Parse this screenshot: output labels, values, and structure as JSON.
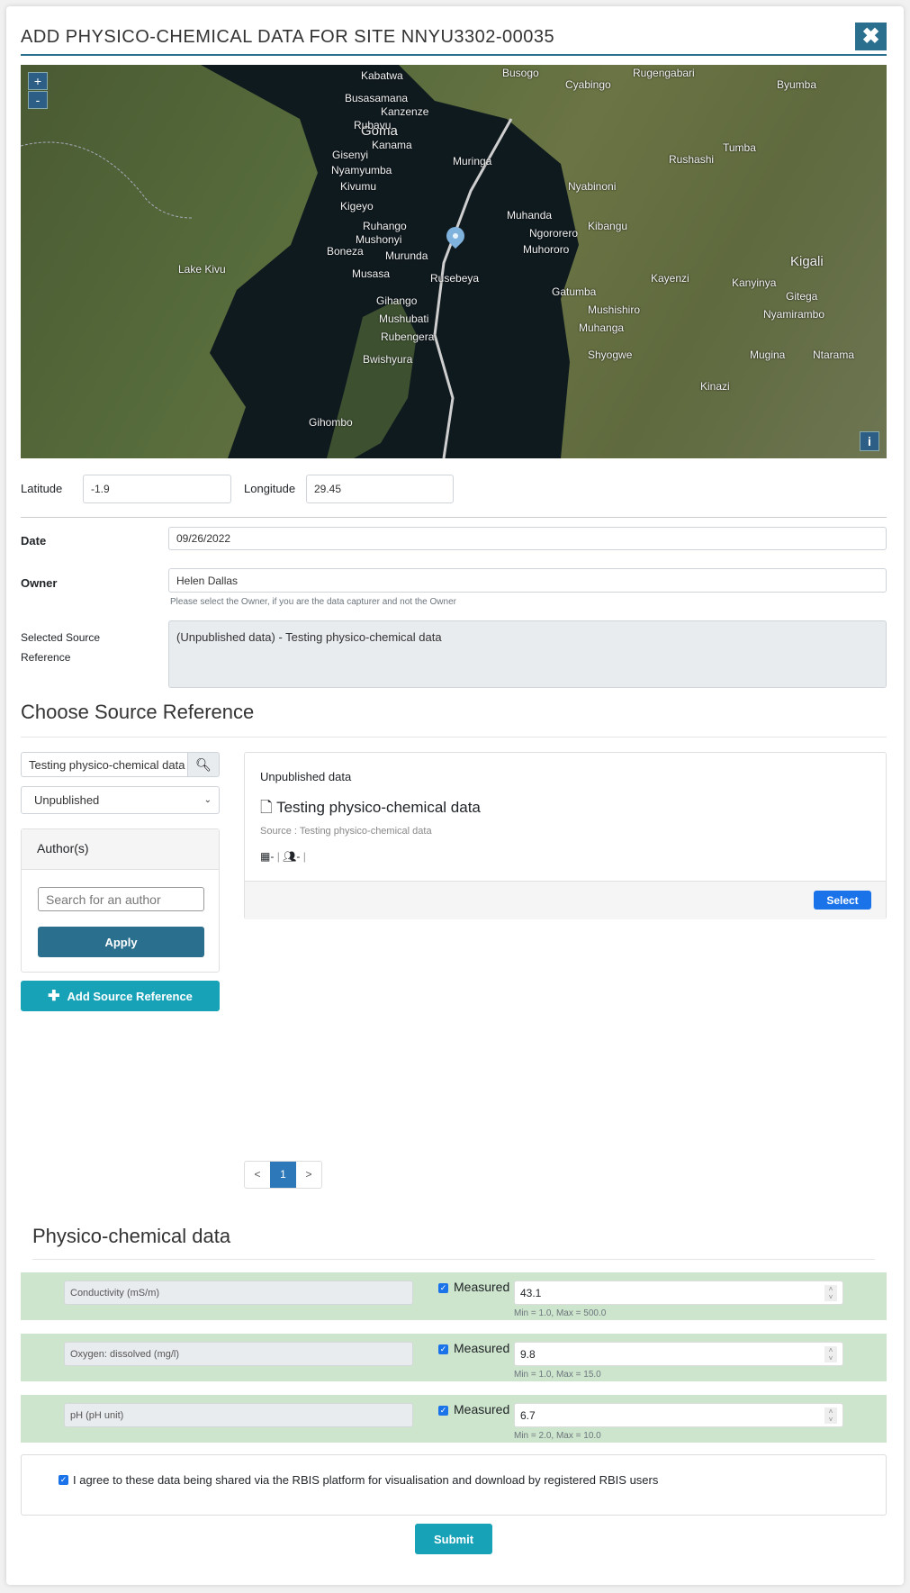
{
  "modal": {
    "title": "ADD PHYSICO-CHEMICAL DATA FOR SITE NNYU3302-00035",
    "close_icon": "close-icon"
  },
  "map": {
    "zoom_in": "+",
    "zoom_out": "-",
    "info": "i",
    "labels": [
      "Goma",
      "Gisenyi",
      "Kabatwa",
      "Busasamana",
      "Kanzenze",
      "Rubavu",
      "Kanama",
      "Nyamyumba",
      "Kivumu",
      "Kigeyo",
      "Ruhango",
      "Mushonyi",
      "Lake Kivu",
      "Boneza",
      "Murunda",
      "Musasa",
      "Rusebeya",
      "Gihango",
      "Mushubati",
      "Rubengera",
      "Bwishyura",
      "Muringa",
      "Busogo",
      "Cyabingo",
      "Rugengabari",
      "Muhanda",
      "Ngororero",
      "Muhororo",
      "Kibangu",
      "Kigali",
      "Kanyinya",
      "Gitega",
      "Nyamirambo",
      "Muhanga",
      "Mushishiro",
      "Gatumba",
      "Kayenzi",
      "Mugina",
      "Ntarama",
      "Kinazi",
      "Gihombo",
      "Shyogwe",
      "Nyabinoni",
      "Rushashi",
      "Tumba",
      "Byumba"
    ]
  },
  "location": {
    "latitude_label": "Latitude",
    "latitude": "-1.9",
    "longitude_label": "Longitude",
    "longitude": "29.45"
  },
  "form": {
    "date_label": "Date",
    "date": "09/26/2022",
    "owner_label": "Owner",
    "owner": "Helen Dallas",
    "owner_help": "Please select the Owner, if you are the data capturer and not the Owner",
    "source_label": "Selected Source Reference",
    "source_value": "(Unpublished data) - Testing physico-chemical data"
  },
  "source": {
    "heading": "Choose Source Reference",
    "search_value": "Testing physico-chemical data",
    "type_select": "Unpublished",
    "authors_heading": "Author(s)",
    "author_placeholder": "Search for an author",
    "apply": "Apply",
    "add_source": "Add Source Reference",
    "result": {
      "category": "Unpublished data",
      "title": "Testing physico-chemical data",
      "source": "Source : Testing physico-chemical data",
      "date": "-",
      "authors": "-",
      "select": "Select"
    },
    "pagination": {
      "prev": "<",
      "current": "1",
      "next": ">"
    }
  },
  "physico": {
    "heading": "Physico-chemical data",
    "measured_label": "Measured",
    "rows": [
      {
        "name": "Conductivity (mS/m)",
        "value": "43.1",
        "range": "Min = 1.0, Max = 500.0",
        "measured": true
      },
      {
        "name": "Oxygen: dissolved (mg/l)",
        "value": "9.8",
        "range": "Min = 1.0, Max = 15.0",
        "measured": true
      },
      {
        "name": "pH (pH unit)",
        "value": "6.7",
        "range": "Min = 2.0, Max = 10.0",
        "measured": true
      }
    ]
  },
  "consent": {
    "checked": true,
    "text": "I agree to these data being shared via the RBIS platform for visualisation and download by registered RBIS users"
  },
  "submit": "Submit",
  "colors": {
    "primary": "#2a6f8e",
    "teal": "#17a2b8",
    "select_blue": "#1a73e8",
    "row_green": "#cde5cc"
  }
}
